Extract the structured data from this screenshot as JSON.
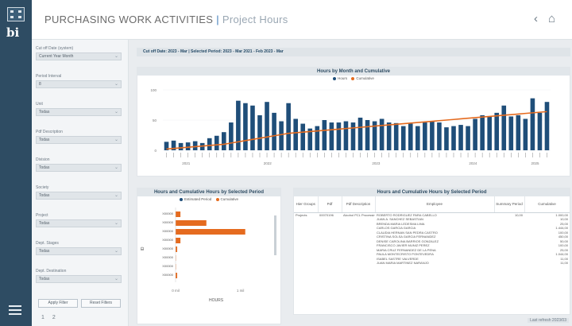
{
  "header": {
    "title_main": "PURCHASING WORK ACTIVITIES",
    "separator": "|",
    "title_sub": "Project Hours"
  },
  "filters": [
    {
      "label": "Cut off Date (system)",
      "value": "Current Year Month"
    },
    {
      "label": "Period Interval",
      "value": "8"
    },
    {
      "label": "Unit",
      "value": "Todas"
    },
    {
      "label": "Pdf Description",
      "value": "Todas"
    },
    {
      "label": "Division",
      "value": "Todas"
    },
    {
      "label": "Society",
      "value": "Todas"
    },
    {
      "label": "Project",
      "value": "Todas"
    },
    {
      "label": "Dept. Stages",
      "value": "Todas"
    },
    {
      "label": "Dept. Destination",
      "value": "Todas"
    }
  ],
  "filter_buttons": {
    "apply": "Apply Filter",
    "reset": "Reset Filters"
  },
  "pager": "1 2",
  "info_bar": "Cut off Date: 2023 - Mar  |  Selected Period: 2023 - Mar 2021 - Feb 2023 - Mar",
  "chart_data": [
    {
      "type": "bar",
      "title": "Hours by Month and Cumulative",
      "legend": [
        "Hours",
        "Cumulative"
      ],
      "year_labels": [
        "2021",
        "2022",
        "2023",
        "2024",
        "2025"
      ],
      "yticks": [
        "100",
        "50",
        "0"
      ],
      "series": [
        {
          "name": "Hours",
          "values": [
            14,
            16,
            12,
            13,
            15,
            12,
            20,
            24,
            30,
            46,
            82,
            78,
            74,
            58,
            80,
            62,
            48,
            78,
            52,
            44,
            36,
            40,
            50,
            46,
            46,
            48,
            46,
            54,
            50,
            48,
            52,
            46,
            45,
            40,
            44,
            40,
            46,
            48,
            46,
            38,
            40,
            42,
            40,
            52,
            58,
            56,
            62,
            74,
            56,
            58,
            52,
            86,
            62,
            80
          ]
        },
        {
          "name": "Cumulative",
          "values": [
            2,
            3,
            4,
            5,
            6,
            7,
            8,
            9,
            10,
            12,
            14,
            16,
            18,
            20,
            22,
            24,
            26,
            28,
            29,
            30,
            31,
            32,
            33,
            34,
            35,
            36,
            37,
            38,
            39,
            40,
            41,
            42,
            43,
            44,
            45,
            46,
            47,
            48,
            49,
            50,
            51,
            52,
            53,
            54,
            55,
            56,
            57,
            58,
            59,
            60,
            61,
            62,
            63,
            64
          ]
        }
      ]
    },
    {
      "type": "bar",
      "title": "Hours and Cumulative Hours by Selected Period",
      "legend": [
        "Estimated Period",
        "Cumulative"
      ],
      "xlabel": "HOURS",
      "ylabel": "ID",
      "categories": [
        "X00000",
        "X00000",
        "X00000",
        "X00000",
        "X00000",
        "X00000",
        "X00000",
        "X00000"
      ],
      "values": [
        6,
        38,
        86,
        6,
        2,
        0,
        0,
        2
      ],
      "xticks": [
        "0 mil",
        "1 mil"
      ]
    }
  ],
  "table": {
    "title": "Hours and Cumulative Hours by Selected Period",
    "columns": [
      "Hier Groups",
      "Pdf",
      "Pdf Description",
      "Employee",
      "Summary Period",
      "Cumulative"
    ],
    "rows": [
      [
        "Projects",
        "00070196",
        "Alcohol PCL Processing B",
        "ROBERTO RODRIGUEZ PARA CABELLO",
        "10,00",
        "1.000,00"
      ],
      [
        "",
        "",
        "",
        "JUAN A. SANCHEZ SEBASTIAN",
        "",
        "10,00"
      ],
      [
        "",
        "",
        "",
        "BRENDA MARIA LEDESMA LIMA",
        "",
        "25,00"
      ],
      [
        "",
        "",
        "",
        "CARLOS GARCIA GARCIA",
        "",
        "1.444,00"
      ],
      [
        "",
        "",
        "",
        "CLAUDIA HERNAN SAN PEDRA CASTRO",
        "",
        "100,00"
      ],
      [
        "",
        "",
        "",
        "CRISTINA SOLSA GARCIA FERNANDEZ",
        "",
        "450,00"
      ],
      [
        "",
        "",
        "",
        "DENISE CAROLINA BARRIOS GONZALEZ",
        "",
        "50,00"
      ],
      [
        "",
        "",
        "",
        "FRANCISCO JAVIER MUNIZ PEREZ",
        "",
        "100,00"
      ],
      [
        "",
        "",
        "",
        "MARIA CRUZ FERNANDEZ DE LA PENA",
        "",
        "25,00"
      ],
      [
        "",
        "",
        "",
        "PAULA MONTECRISTO PONTEVEDRA",
        "",
        "1.044,00"
      ],
      [
        "",
        "",
        "",
        "ISABEL SASTRE VALVERDE",
        "",
        "11,00"
      ],
      [
        "",
        "",
        "",
        "JUAN MARIA MARTINEZ NARANJO",
        "",
        "11,00"
      ]
    ]
  },
  "footnote": "Last refresh 2023/03"
}
